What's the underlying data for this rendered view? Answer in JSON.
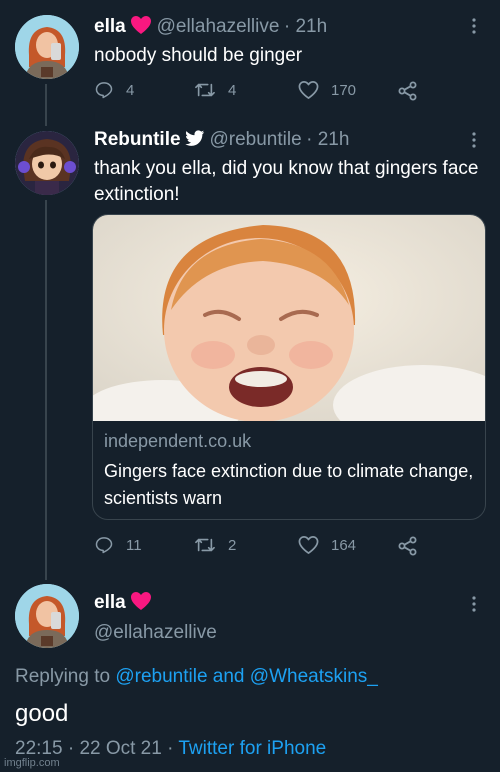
{
  "tweet1": {
    "name": "ella",
    "handle": "@ellahazellive",
    "time": "· 21h",
    "text": "nobody should be ginger",
    "replies": "4",
    "retweets": "4",
    "likes": "170"
  },
  "tweet2": {
    "name": "Rebuntile",
    "handle": "@rebuntile",
    "time": "· 21h",
    "text": "thank you ella, did you know that gingers face extinction!",
    "card": {
      "domain": "independent.co.uk",
      "title": "Gingers face extinction due to climate change, scientists warn"
    },
    "replies": "11",
    "retweets": "2",
    "likes": "164"
  },
  "tweet3": {
    "name": "ella",
    "handle": "@ellahazellive",
    "replying_prefix": "Replying to",
    "replying_to_1": "@rebuntile",
    "replying_and": "and",
    "replying_to_2": "@Wheatskins_",
    "text": "good",
    "time": "22:15",
    "date": "22 Oct 21",
    "source": "Twitter for iPhone"
  },
  "watermark": "imgflip.com",
  "colors": {
    "background": "#15202b",
    "secondary_text": "#8899a6",
    "link": "#1da1f2",
    "heart": "#f91880",
    "border": "#38444d"
  },
  "icons": [
    "reply-icon",
    "retweet-icon",
    "like-icon",
    "share-icon",
    "more-icon",
    "heart-emoji",
    "twitter-bird-icon"
  ]
}
